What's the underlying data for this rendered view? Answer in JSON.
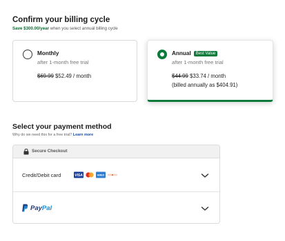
{
  "billing": {
    "title": "Confirm your billing cycle",
    "savings_amount": "Save $300.00/year",
    "savings_suffix": " when you select annual billing cycle"
  },
  "plans": [
    {
      "name": "Monthly",
      "trial": "after 1-month free trial",
      "old_price": "$69.99",
      "price": " $52.49 / month",
      "selected": false
    },
    {
      "name": "Annual",
      "badge": "Best Value",
      "trial": "after 1-month free trial",
      "old_price": "$44.99",
      "price": " $33.74 / month",
      "billed_note": "(billed annually as $404.91)",
      "selected": true
    }
  ],
  "payment": {
    "title": "Select your payment method",
    "why_text": "Why do we need this for a free trial? ",
    "learn_more": "Learn more",
    "secure_label": "Secure Checkout",
    "methods": [
      {
        "label": "Credit/Debit card",
        "icons": [
          "visa-icon",
          "mastercard-icon",
          "amex-icon",
          "discover-icon"
        ]
      },
      {
        "label": "PayPal",
        "brand_part1": "Pay",
        "brand_part2": "Pal"
      }
    ],
    "card_logo_labels": [
      "VISA",
      "AMEX"
    ]
  },
  "colors": {
    "accent_green": "#0b7a3b",
    "link_blue": "#1a4fa3",
    "paypal_dark": "#1e3a7b",
    "paypal_light": "#1b8fd8"
  }
}
